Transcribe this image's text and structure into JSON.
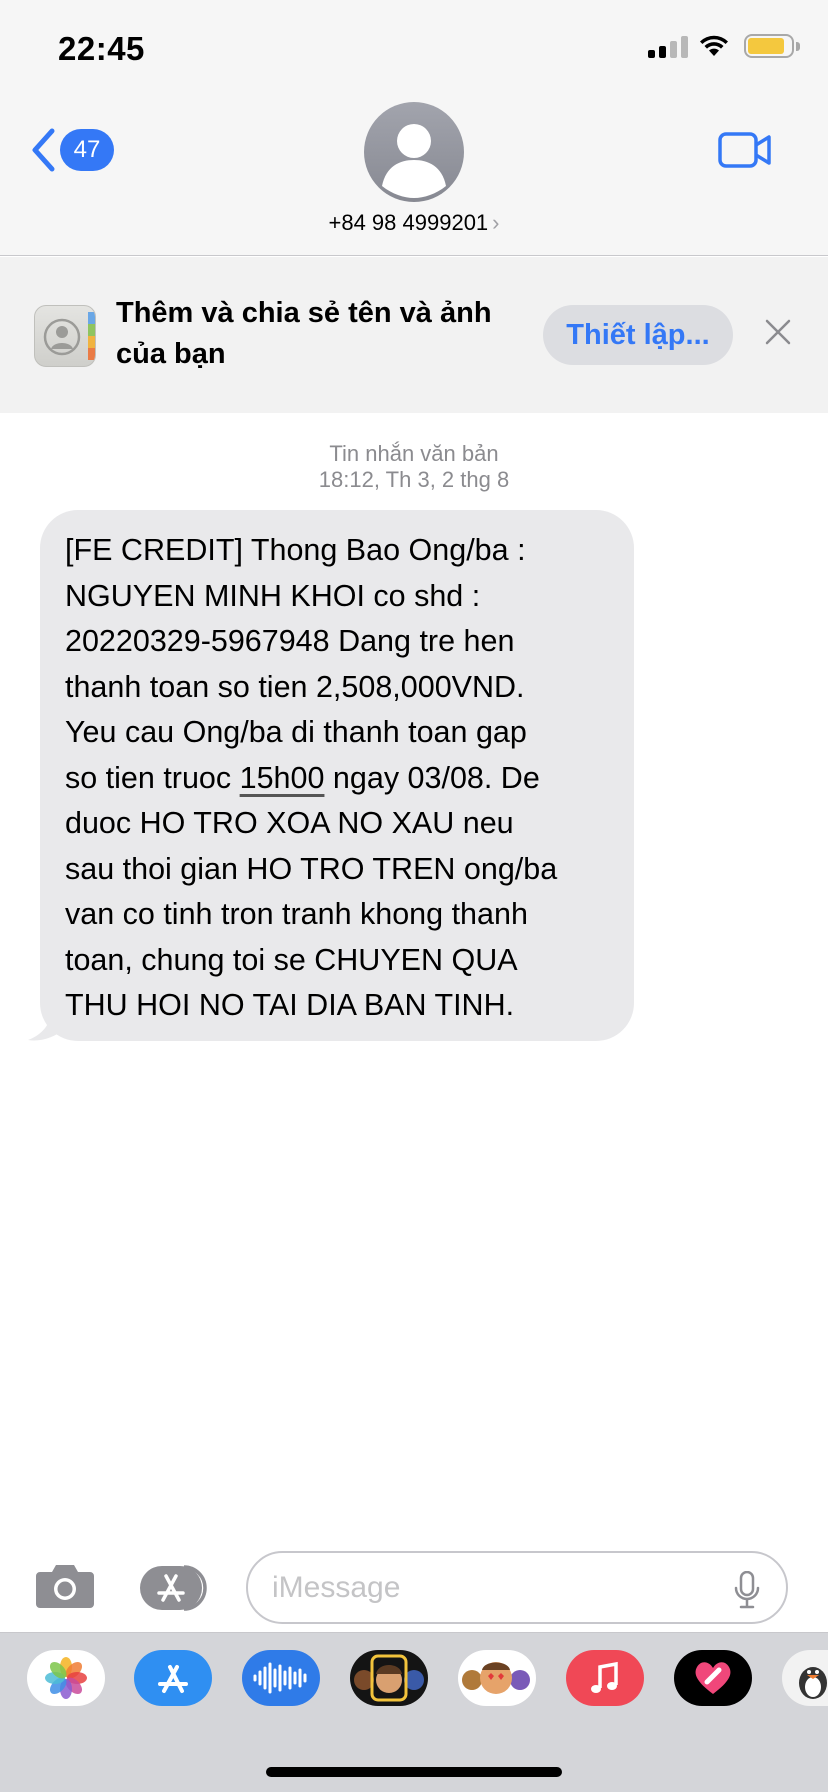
{
  "status_bar": {
    "time": "22:45"
  },
  "nav": {
    "unread_count": "47",
    "contact": "+84 98 4999201"
  },
  "banner": {
    "text": "Thêm và chia sẻ tên và ảnh của bạn",
    "button": "Thiết lập..."
  },
  "thread": {
    "label": "Tin nhắn văn bản",
    "timestamp": "18:12, Th 3, 2 thg 8",
    "message": {
      "lines": [
        "[FE CREDIT] Thong Bao Ong/ba :",
        "NGUYEN MINH KHOI co shd :",
        "20220329-5967948 Dang tre hen",
        "thanh toan so tien 2,508,000VND.",
        "Yeu cau Ong/ba di thanh toan gap",
        "so tien truoc ",
        "15h00",
        " ngay 03/08. De",
        "duoc HO TRO XOA NO XAU neu",
        "sau thoi gian HO TRO TREN ong/ba",
        "van co tinh tron tranh khong thanh",
        "toan, chung toi se CHUYEN QUA",
        "THU HOI NO TAI DIA BAN TINH."
      ]
    }
  },
  "composer": {
    "placeholder": "iMessage"
  },
  "app_drawer": {
    "apps": [
      "photos-icon",
      "app-store-icon",
      "audio-message-icon",
      "memoji-icon",
      "animoji-icon",
      "music-icon",
      "digital-touch-icon",
      "sticker-icon"
    ]
  },
  "colors": {
    "accent": "#3478f6",
    "bubble": "#e9e9eb",
    "battery": "#f4c83e"
  }
}
